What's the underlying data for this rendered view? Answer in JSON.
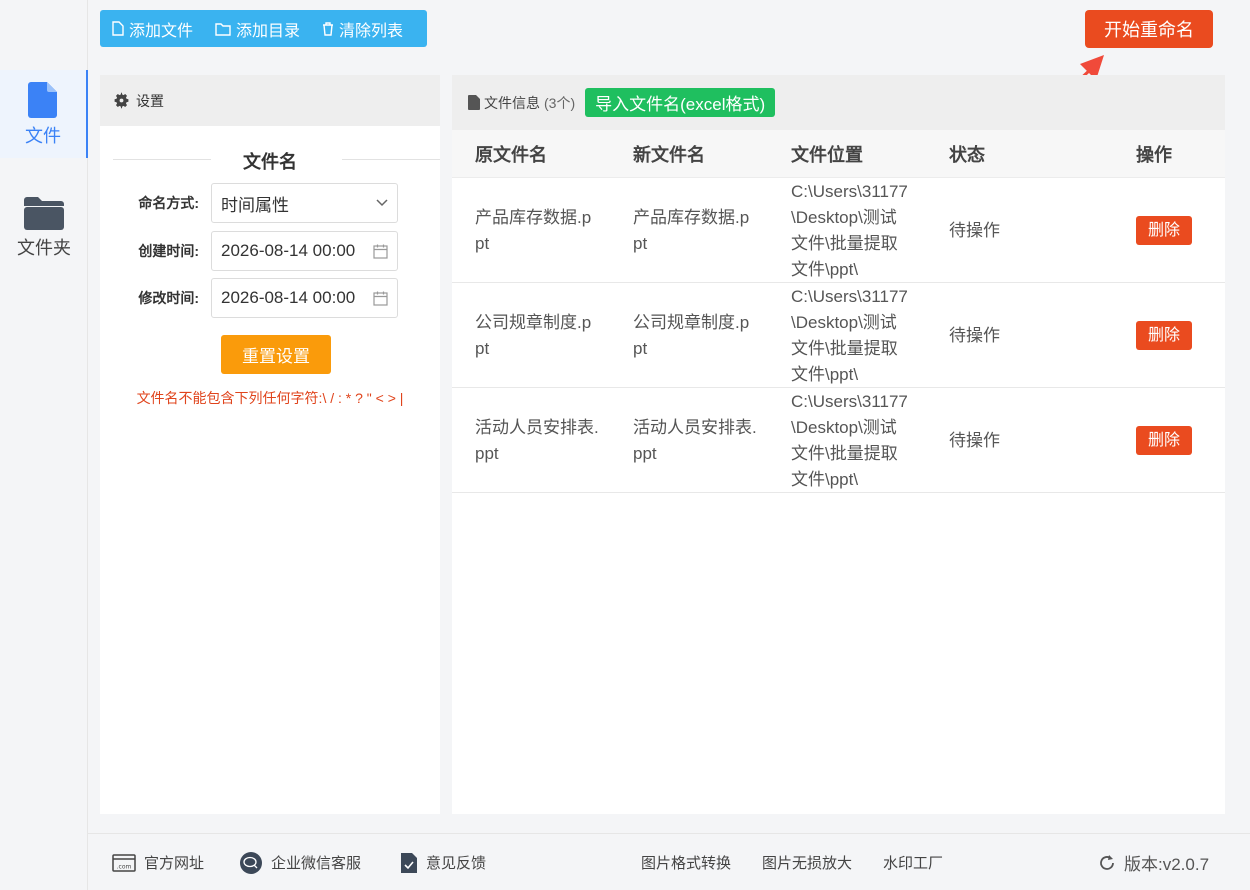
{
  "rail": {
    "items": [
      {
        "label": "文件",
        "icon": "file-icon",
        "active": true
      },
      {
        "label": "文件夹",
        "icon": "folder-icon",
        "active": false
      }
    ]
  },
  "toolbar": {
    "add_file": "添加文件",
    "add_dir": "添加目录",
    "clear_list": "清除列表"
  },
  "start_button": "开始重命名",
  "settings": {
    "header": "设置",
    "section_title": "文件名",
    "naming_label": "命名方式:",
    "naming_value": "时间属性",
    "created_label": "创建时间:",
    "created_value": "2026-08-14 00:00",
    "modified_label": "修改时间:",
    "modified_value": "2026-08-14 00:00",
    "reset_button": "重置设置",
    "warning": "文件名不能包含下列任何字符:\\ / : * ? \" < > |"
  },
  "files": {
    "header": "文件信息",
    "count": "(3个)",
    "import_button": "导入文件名(excel格式)",
    "columns": [
      "原文件名",
      "新文件名",
      "文件位置",
      "状态",
      "操作"
    ],
    "rows": [
      {
        "original": "产品库存数据.ppt",
        "new": "产品库存数据.ppt",
        "path": "C:\\Users\\31177\\Desktop\\测试文件\\批量提取文件\\ppt\\",
        "status": "待操作",
        "action": "删除"
      },
      {
        "original": "公司规章制度.ppt",
        "new": "公司规章制度.ppt",
        "path": "C:\\Users\\31177\\Desktop\\测试文件\\批量提取文件\\ppt\\",
        "status": "待操作",
        "action": "删除"
      },
      {
        "original": "活动人员安排表.ppt",
        "new": "活动人员安排表.ppt",
        "path": "C:\\Users\\31177\\Desktop\\测试文件\\批量提取文件\\ppt\\",
        "status": "待操作",
        "action": "删除"
      }
    ]
  },
  "footer": {
    "website": "官方网址",
    "wechat": "企业微信客服",
    "feedback": "意见反馈",
    "img_convert": "图片格式转换",
    "img_upscale": "图片无损放大",
    "watermark": "水印工厂",
    "version": "版本:v2.0.7"
  },
  "colors": {
    "accent_blue": "#3b82f6",
    "toolbar_blue": "#3ab3f0",
    "danger_red": "#ea4b1f",
    "reset_orange": "#fa9b0b",
    "import_green": "#1fbf5f"
  }
}
